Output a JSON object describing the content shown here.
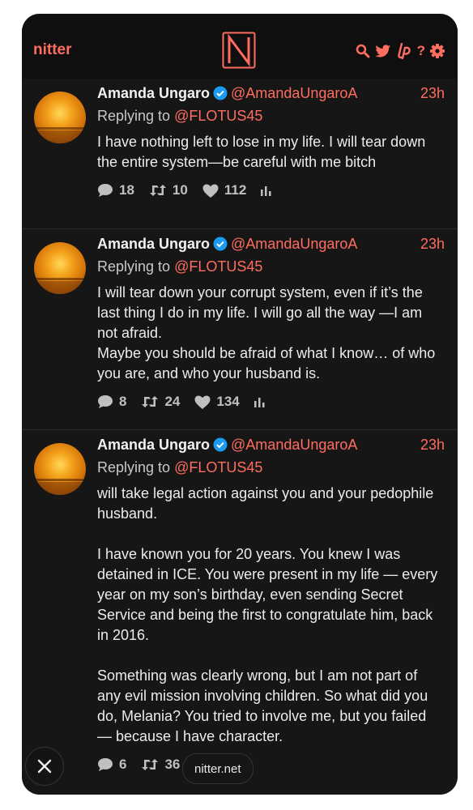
{
  "nav": {
    "brand": "nitter",
    "logo_letter": "N",
    "icons": [
      "search-icon",
      "twitter-bird-icon",
      "liberapay-icon",
      "help-icon",
      "settings-gear-icon"
    ],
    "help_glyph": "?",
    "accent_color": "#ff6c60"
  },
  "tweets": [
    {
      "name": "Amanda Ungaro",
      "handle": "@AmandaUngaroA",
      "time": "23h",
      "reply_prefix": "Replying to",
      "reply_to": "@FLOTUS45",
      "body": "I have nothing left to lose in my life. I will tear down the entire system—be careful with me bitch",
      "replies": "18",
      "retweets": "10",
      "likes": "112"
    },
    {
      "name": "Amanda Ungaro",
      "handle": "@AmandaUngaroA",
      "time": "23h",
      "reply_prefix": "Replying to",
      "reply_to": "@FLOTUS45",
      "body": "I will tear down your corrupt system, even if it’s the last thing I do in my life. I will go all the way —I am not afraid.\nMaybe you should be afraid of what I know… of who you are, and who your husband is.",
      "replies": "8",
      "retweets": "24",
      "likes": "134"
    },
    {
      "name": "Amanda Ungaro",
      "handle": "@AmandaUngaroA",
      "time": "23h",
      "reply_prefix": "Replying to",
      "reply_to": "@FLOTUS45",
      "body": "will take legal action against you and your pedophile husband.\n\nI have known you for 20 years. You knew I was detained in ICE. You were present in my life — every year on my son’s birthday, even sending Secret Service and being the first to congratulate him, back in 2016.\n\nSomething was clearly wrong, but I am not part of any evil mission involving children. So what did you do, Melania? You tried to involve me, but you failed — because I have character.",
      "replies": "6",
      "retweets": "36",
      "likes": ""
    }
  ],
  "browser": {
    "url": "nitter.net",
    "close_icon": "close-icon"
  }
}
